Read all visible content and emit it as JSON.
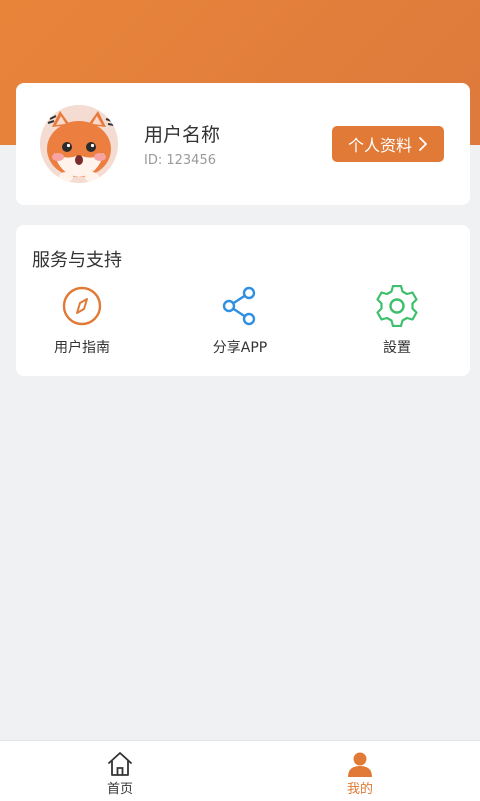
{
  "profile": {
    "username": "用户名称",
    "user_id": "ID: 123456",
    "profile_button_label": "个人资料",
    "avatar_icon": "fox-avatar-icon"
  },
  "services": {
    "title": "服务与支持",
    "items": [
      {
        "label": "用户指南",
        "icon": "compass-icon",
        "color": "#e07a36"
      },
      {
        "label": "分享APP",
        "icon": "share-icon",
        "color": "#2f8fe0"
      },
      {
        "label": "設置",
        "icon": "gear-icon",
        "color": "#3fbf6b"
      }
    ]
  },
  "bottom_nav": {
    "tabs": [
      {
        "label": "首页",
        "icon": "home-icon",
        "active": false
      },
      {
        "label": "我的",
        "icon": "user-icon",
        "active": true
      }
    ]
  },
  "colors": {
    "accent": "#e07a36",
    "header": "#e8843a",
    "background": "#f0f1f3"
  }
}
